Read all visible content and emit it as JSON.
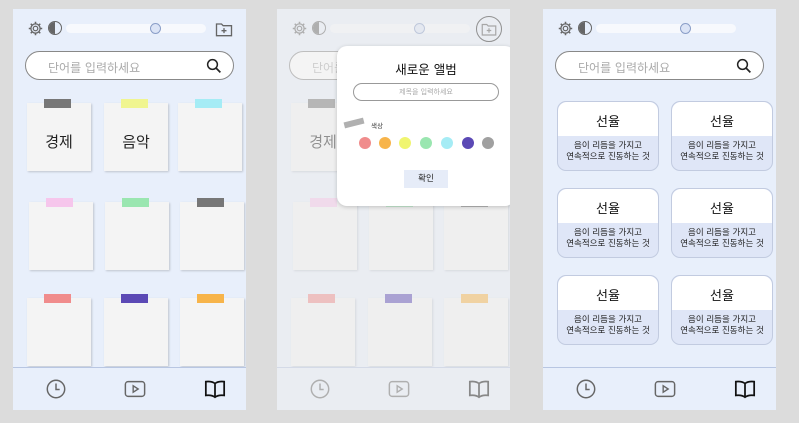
{
  "search": {
    "placeholder": "단어를 입력하세요"
  },
  "screen1": {
    "slider_value": 0.65,
    "notes": [
      {
        "label": "경제",
        "tape": "#777777"
      },
      {
        "label": "음악",
        "tape": "#f0f590"
      },
      {
        "label": "",
        "tape": "#a5ecf5"
      },
      {
        "label": "",
        "tape": "#f6c6ec"
      },
      {
        "label": "",
        "tape": "#9ae6b0"
      },
      {
        "label": "",
        "tape": "#777777"
      },
      {
        "label": "",
        "tape": "#f08c8c"
      },
      {
        "label": "",
        "tape": "#5b49b5"
      },
      {
        "label": "",
        "tape": "#f7b44a"
      }
    ]
  },
  "screen2": {
    "slider_value": 0.65,
    "first_note_label": "경제",
    "modal": {
      "title": "새로운 앨범",
      "input_placeholder": "제목을 입력하세요",
      "color_label": "색상",
      "colors": [
        "#f08c8c",
        "#f7b44a",
        "#f0f570",
        "#9ae6b0",
        "#a5ecf5",
        "#5b49b5",
        "#a0a0a0"
      ],
      "confirm_label": "확인"
    }
  },
  "screen3": {
    "slider_value": 0.65,
    "cards": [
      {
        "title": "선율",
        "desc1": "음이 리듬을 가지고",
        "desc2": "연속적으로 진동하는 것"
      },
      {
        "title": "선율",
        "desc1": "음이 리듬을 가지고",
        "desc2": "연속적으로 진동하는 것"
      },
      {
        "title": "선율",
        "desc1": "음이 리듬을 가지고",
        "desc2": "연속적으로 진동하는 것"
      },
      {
        "title": "선율",
        "desc1": "음이 리듬을 가지고",
        "desc2": "연속적으로 진동하는 것"
      },
      {
        "title": "선율",
        "desc1": "음이 리듬을 가지고",
        "desc2": "연속적으로 진동하는 것"
      },
      {
        "title": "선율",
        "desc1": "음이 리듬을 가지고",
        "desc2": "연속적으로 진동하는 것"
      }
    ]
  },
  "icons": {
    "settings": "gear-icon",
    "theme": "contrast-icon",
    "add_album": "add-album-icon",
    "search": "search-icon",
    "nav_history": "clock-icon",
    "nav_video": "play-icon",
    "nav_book": "book-icon"
  }
}
